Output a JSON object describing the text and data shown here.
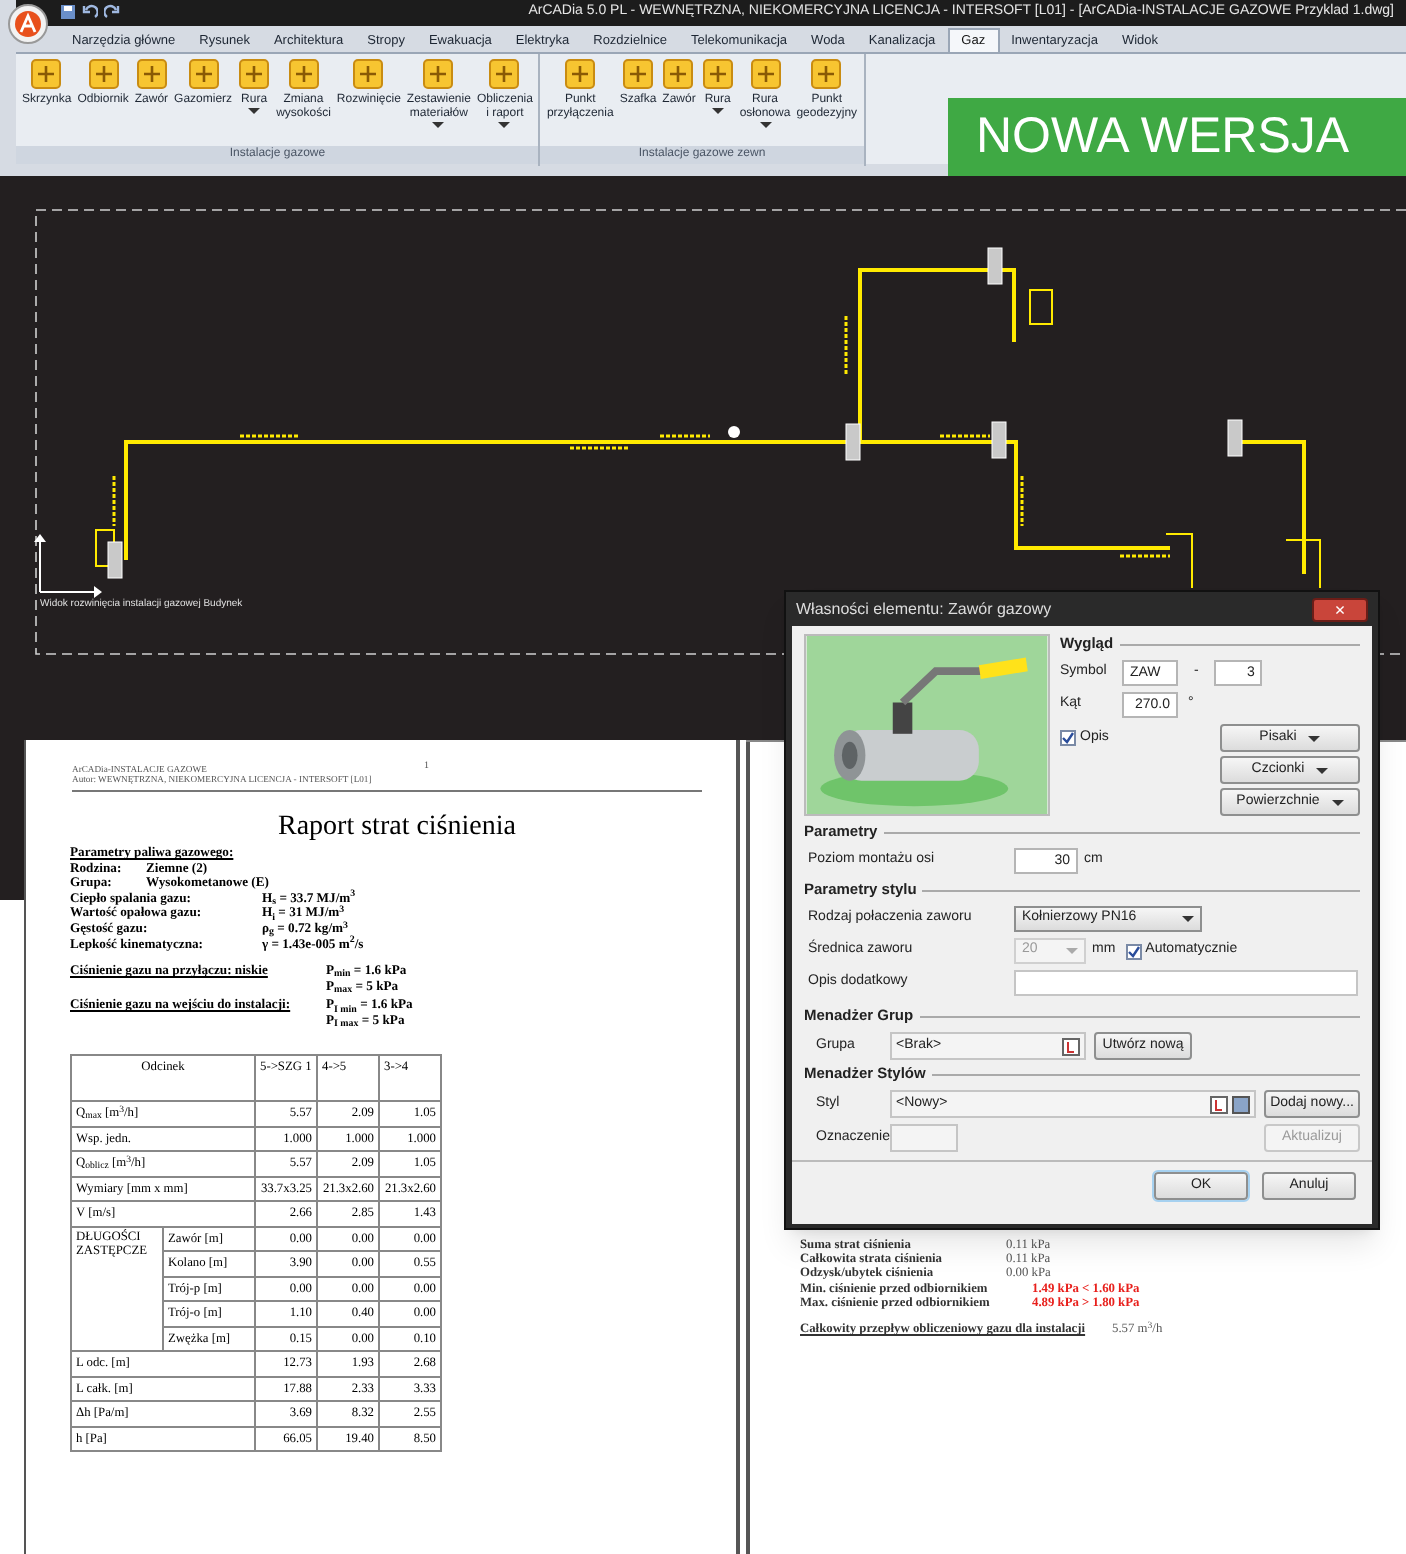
{
  "app_window": {
    "title": "ArCADia 5.0 PL - WEWNĘTRZNA, NIEKOMERCYJNA LICENCJA - INTERSOFT [L01] - [ArCADia-INSTALACJE GAZOWE Przyklad 1.dwg]",
    "tabs": [
      {
        "label": "Narzędzia główne",
        "selected": false
      },
      {
        "label": "Rysunek",
        "selected": false
      },
      {
        "label": "Architektura",
        "selected": false
      },
      {
        "label": "Stropy",
        "selected": false
      },
      {
        "label": "Ewakuacja",
        "selected": false
      },
      {
        "label": "Elektryka",
        "selected": false
      },
      {
        "label": "Rozdzielnice",
        "selected": false
      },
      {
        "label": "Telekomunikacja",
        "selected": false
      },
      {
        "label": "Woda",
        "selected": false
      },
      {
        "label": "Kanalizacja",
        "selected": false
      },
      {
        "label": "Gaz",
        "selected": true
      },
      {
        "label": "Inwentaryzacja",
        "selected": false
      },
      {
        "label": "Widok",
        "selected": false
      }
    ],
    "ribbon_groups": [
      {
        "label": "Instalacje gazowe",
        "buttons": [
          {
            "label": "Skrzynka",
            "dropdown": false
          },
          {
            "label": "Odbiornik",
            "dropdown": false
          },
          {
            "label": "Zawór",
            "dropdown": false
          },
          {
            "label": "Gazomierz",
            "dropdown": false
          },
          {
            "label": "Rura",
            "dropdown": true
          },
          {
            "label": "Zmiana\nwysokości",
            "dropdown": false
          },
          {
            "label": "Rozwinięcie",
            "dropdown": false
          },
          {
            "label": "Zestawienie\nmateriałów",
            "dropdown": true
          },
          {
            "label": "Obliczenia\ni raport",
            "dropdown": true
          }
        ]
      },
      {
        "label": "Instalacje gazowe zewn",
        "buttons": [
          {
            "label": "Punkt\nprzyłączenia",
            "dropdown": false
          },
          {
            "label": "Szafka",
            "dropdown": false
          },
          {
            "label": "Zawór",
            "dropdown": false
          },
          {
            "label": "Rura",
            "dropdown": true
          },
          {
            "label": "Rura\nosłonowa",
            "dropdown": true
          },
          {
            "label": "Punkt\ngeodezyjny",
            "dropdown": false
          }
        ]
      }
    ]
  },
  "banner": {
    "text": "NOWA WERSJA"
  },
  "drawing": {
    "caption": "Widok rozwinięcia instalacji gazowej Budynek"
  },
  "report": {
    "header_lines": [
      "ArCADia-INSTALACJE GAZOWE",
      "Autor: WEWNĘTRZNA, NIEKOMERCYJNA LICENCJA - INTERSOFT [L01]"
    ],
    "page_number": "1",
    "title": "Raport strat ciśnienia",
    "params_heading": "Parametry paliwa gazowego:",
    "params": [
      {
        "label": "Rodzina:",
        "value": "Ziemne (2)"
      },
      {
        "label": "Grupa:",
        "value": "Wysokometanowe (E)"
      },
      {
        "label": "Ciepło spalania gazu:",
        "value": "H$_{s}$ = 33.7 MJ/m$^{3}$"
      },
      {
        "label": "Wartość opałowa gazu:",
        "value": "H$_{i}$ = 31 MJ/m$^{3}$"
      },
      {
        "label": "Gęstość gazu:",
        "value": "ρ$_{g}$ = 0.72 kg/m$^{3}$"
      },
      {
        "label": "Lepkość kinematyczna:",
        "value": "γ = 1.43e-005 m$^{2}$/s"
      }
    ],
    "pressures": [
      {
        "label": "Ciśnienie gazu na przyłączu: niskie",
        "values": [
          "P$_{min}$ = 1.6 kPa",
          "P$_{max}$ = 5 kPa"
        ]
      },
      {
        "label": "Ciśnienie gazu na wejściu do instalacji:",
        "values": [
          "P$_{I min}$ = 1.6 kPa",
          "P$_{I max}$ = 5 kPa"
        ]
      }
    ],
    "table": {
      "columns": [
        "Odcinek",
        "5->SZG 1",
        "4->5",
        "3->4"
      ],
      "rows": [
        {
          "kind": "single",
          "label": "Q$_{max}$ [m$^{3}$/h]",
          "values": [
            "5.57",
            "2.09",
            "1.05"
          ]
        },
        {
          "kind": "single",
          "label": "Wsp. jedn.",
          "values": [
            "1.000",
            "1.000",
            "1.000"
          ]
        },
        {
          "kind": "single",
          "label": "Q$_{oblicz}$ [m$^{3}$/h]",
          "values": [
            "5.57",
            "2.09",
            "1.05"
          ]
        },
        {
          "kind": "single",
          "label": "Wymiary [mm x mm]",
          "values": [
            "33.7x3.25",
            "21.3x2.60",
            "21.3x2.60"
          ]
        },
        {
          "kind": "single",
          "label": "V [m/s]",
          "values": [
            "2.66",
            "2.85",
            "1.43"
          ]
        },
        {
          "kind": "group",
          "label": "DŁUGOŚCI ZASTĘPCZE",
          "children": [
            {
              "label": "Zawór [m]",
              "values": [
                "0.00",
                "0.00",
                "0.00"
              ]
            },
            {
              "label": "Kolano [m]",
              "values": [
                "3.90",
                "0.00",
                "0.55"
              ]
            },
            {
              "label": "Trój-p [m]",
              "values": [
                "0.00",
                "0.00",
                "0.00"
              ]
            },
            {
              "label": "Trój-o [m]",
              "values": [
                "1.10",
                "0.40",
                "0.00"
              ]
            },
            {
              "label": "Zwężka [m]",
              "values": [
                "0.15",
                "0.00",
                "0.10"
              ]
            }
          ]
        },
        {
          "kind": "single",
          "label": "L odc. [m]",
          "values": [
            "12.73",
            "1.93",
            "2.68"
          ]
        },
        {
          "kind": "single",
          "label": "L całk. [m]",
          "values": [
            "17.88",
            "2.33",
            "3.33"
          ]
        },
        {
          "kind": "single",
          "label": "Δh [Pa/m]",
          "values": [
            "3.69",
            "8.32",
            "2.55"
          ]
        },
        {
          "kind": "single",
          "label": "h [Pa]",
          "values": [
            "66.05",
            "19.40",
            "8.50"
          ]
        }
      ]
    }
  },
  "dialog": {
    "title": "Własności elementu: Zawór gazowy",
    "close": "×",
    "appearance": {
      "heading": "Wygląd",
      "symbol_label": "Symbol",
      "symbol": "ZAW",
      "dash": "-",
      "symbol_number": "3",
      "angle_label": "Kąt",
      "angle": "270.0",
      "angle_unit": "°",
      "description_label": "Opis",
      "description_checked": true,
      "buttons": [
        "Pisaki",
        "Czcionki",
        "Powierzchnie"
      ]
    },
    "parameters": {
      "heading": "Parametry",
      "mount_label": "Poziom montażu osi",
      "mount": "30",
      "mount_unit": "cm"
    },
    "style_parameters": {
      "heading": "Parametry stylu",
      "connection_label": "Rodzaj połaczenia zaworu",
      "connection": "Kołnierzowy PN16",
      "diameter_label": "Średnica zaworu",
      "diameter": "20",
      "diameter_disabled": true,
      "diameter_unit": "mm",
      "auto_label": "Automatycznie",
      "auto_checked": true,
      "extra_label": "Opis dodatkowy"
    },
    "groups": {
      "heading": "Menadżer Grup",
      "group_label": "Grupa",
      "group": "<Brak>",
      "create_button": "Utwórz nową"
    },
    "styles": {
      "heading": "Menadżer Stylów",
      "style_label": "Styl",
      "style": "<Nowy>",
      "add_button": "Dodaj nowy...",
      "mark_label": "Oznaczenie",
      "update_button": "Aktualizuj",
      "update_disabled": true
    },
    "ok": "OK",
    "cancel": "Anuluj"
  },
  "summary": {
    "rows": [
      {
        "label": "Suma strat ciśnienia",
        "value": "0.11 kPa",
        "warning": false
      },
      {
        "label": "Całkowita strata ciśnienia",
        "value": "0.11 kPa",
        "warning": false
      },
      {
        "label": "Odzysk/ubytek ciśnienia",
        "value": "0.00 kPa",
        "warning": false
      },
      {
        "label": "Min. ciśnienie przed odbiornikiem",
        "value": "1.49 kPa < 1.60 kPa",
        "warning": true
      },
      {
        "label": "Max. ciśnienie przed odbiornikiem",
        "value": "4.89 kPa > 1.80 kPa",
        "warning": true
      }
    ],
    "total_label": "Całkowity przepływ obliczeniowy gazu dla instalacji",
    "total_value": "5.57 m$^{3}$/h"
  }
}
